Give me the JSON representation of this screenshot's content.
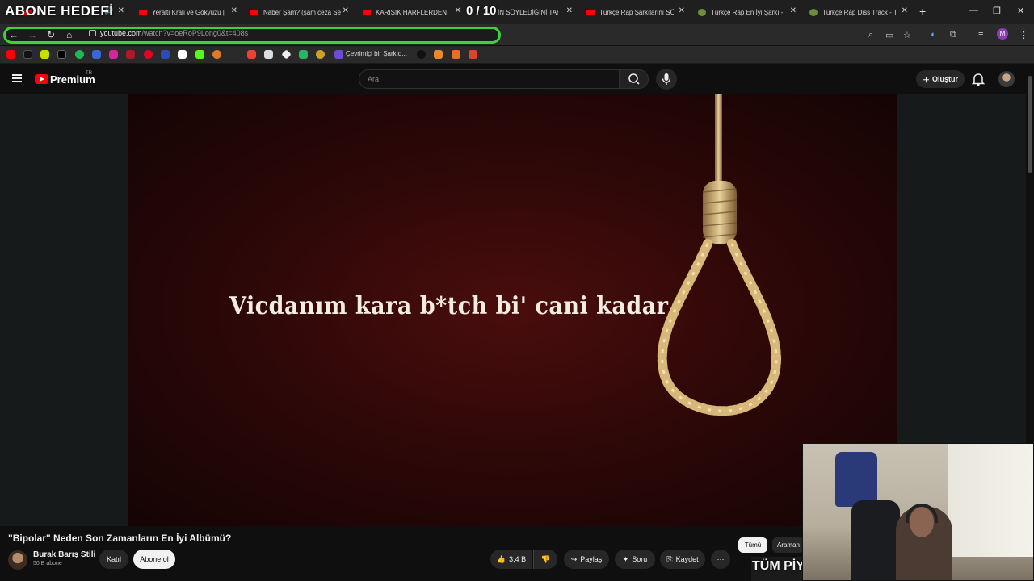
{
  "overlay": {
    "title": "ABONE HEDEFİ",
    "count": "0 / 10"
  },
  "browser": {
    "tabs": [
      {
        "label": "Yeraltı Kralı ve Gökyüzü |"
      },
      {
        "label": "Naber Şam? (şam ceza Se"
      },
      {
        "label": "KARIŞIK HARFLERDEN TÜ"
      },
      {
        "label": "İN SÖYLEDİĞİNİ TAHM"
      },
      {
        "label": "Türkçe Rap Şarkılarını SÖ"
      },
      {
        "label": "Türkçe Rap En İyi Şarkı -"
      },
      {
        "label": "Türkçe Rap Diss Track - T"
      }
    ],
    "url_domain": "youtube.com",
    "url_rest": "/watch?v=oeRoP9Long0&t=408s",
    "profile_initial": "M",
    "bookmark_label": "Çevrimiçi bir Şarkıd..."
  },
  "youtube": {
    "brand": "Premium",
    "region": "TR",
    "search_placeholder": "Ara",
    "create_label": "Oluştur"
  },
  "video": {
    "lyric": "Vicdanım kara b*tch bi' cani kadar",
    "title": "\"Bipolar\" Neden Son Zamanların En İyi Albümü?",
    "channel": "Burak Barış Stili",
    "subscribers": "50 B abone",
    "join_label": "Katıl",
    "subscribe_label": "Abone ol",
    "likes": "3,4 B",
    "share_label": "Paylaş",
    "ask_label": "Soru",
    "save_label": "Kaydet"
  },
  "chips": {
    "all": "Tümü",
    "search": "Araman"
  },
  "stream": {
    "ticker": "TÜM PİYAS"
  },
  "colors": {
    "accent_green": "#3ed13e",
    "youtube_red": "#ff0000",
    "video_bg": "#2a0707"
  }
}
